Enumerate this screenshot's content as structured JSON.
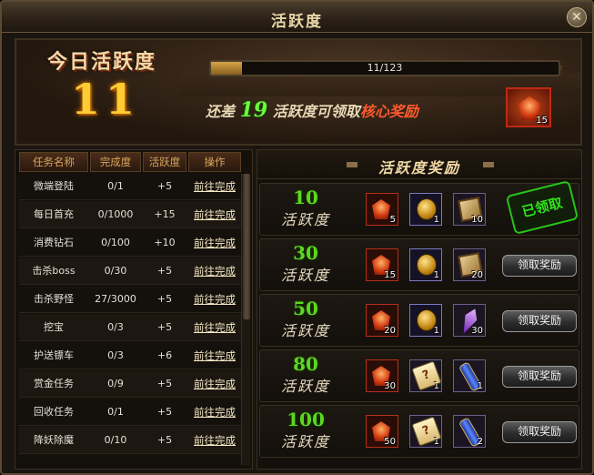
{
  "window": {
    "title": "活跃度",
    "close_icon": "close-icon"
  },
  "banner": {
    "today_label": "今日活跃度",
    "today_value": "11",
    "progress_text": "11/123",
    "progress_fraction": 0.089,
    "need_prefix": "还差",
    "need_value": "19",
    "need_middle": "活跃度可领取",
    "need_core": "核心奖励",
    "core_item_qty": "15"
  },
  "tasks": {
    "headers": [
      "任务名称",
      "完成度",
      "活跃度",
      "操作"
    ],
    "rows": [
      {
        "name": "微端登陆",
        "progress": "0/1",
        "points": "+5",
        "action": "前往完成"
      },
      {
        "name": "每日首充",
        "progress": "0/1000",
        "points": "+15",
        "action": "前往完成"
      },
      {
        "name": "消费钻石",
        "progress": "0/100",
        "points": "+10",
        "action": "前往完成"
      },
      {
        "name": "击杀boss",
        "progress": "0/30",
        "points": "+5",
        "action": "前往完成"
      },
      {
        "name": "击杀野怪",
        "progress": "27/3000",
        "points": "+5",
        "action": "前往完成"
      },
      {
        "name": "挖宝",
        "progress": "0/3",
        "points": "+5",
        "action": "前往完成"
      },
      {
        "name": "护送镖车",
        "progress": "0/3",
        "points": "+6",
        "action": "前往完成"
      },
      {
        "name": "赏金任务",
        "progress": "0/9",
        "points": "+5",
        "action": "前往完成"
      },
      {
        "name": "回收任务",
        "progress": "0/1",
        "points": "+5",
        "action": "前往完成"
      },
      {
        "name": "降妖除魔",
        "progress": "0/10",
        "points": "+5",
        "action": "前往完成"
      }
    ]
  },
  "rewards": {
    "title": "活跃度奖励",
    "level_label": "活跃度",
    "claimed_label": "已领取",
    "claim_label": "领取奖励",
    "tiers": [
      {
        "level": "10",
        "items": [
          {
            "icon": "red-gem-icon",
            "qty": "5"
          },
          {
            "icon": "gold-coin-icon",
            "qty": "1"
          },
          {
            "icon": "skill-book-icon",
            "qty": "10"
          }
        ],
        "claimed": true
      },
      {
        "level": "30",
        "items": [
          {
            "icon": "red-gem-icon",
            "qty": "15"
          },
          {
            "icon": "gold-coin-icon",
            "qty": "1"
          },
          {
            "icon": "skill-book-icon",
            "qty": "20"
          }
        ],
        "claimed": false
      },
      {
        "level": "50",
        "items": [
          {
            "icon": "red-gem-icon",
            "qty": "20"
          },
          {
            "icon": "gold-coin-icon",
            "qty": "1"
          },
          {
            "icon": "purple-crystal-icon",
            "qty": "30"
          }
        ],
        "claimed": false
      },
      {
        "level": "80",
        "items": [
          {
            "icon": "red-gem-icon",
            "qty": "30"
          },
          {
            "icon": "mystery-scroll-icon",
            "qty": "1"
          },
          {
            "icon": "blue-scroll-icon",
            "qty": "1"
          }
        ],
        "claimed": false
      },
      {
        "level": "100",
        "items": [
          {
            "icon": "red-gem-icon",
            "qty": "50"
          },
          {
            "icon": "mystery-scroll-icon",
            "qty": "1"
          },
          {
            "icon": "blue-scroll-icon",
            "qty": "2"
          }
        ],
        "claimed": false
      }
    ]
  }
}
